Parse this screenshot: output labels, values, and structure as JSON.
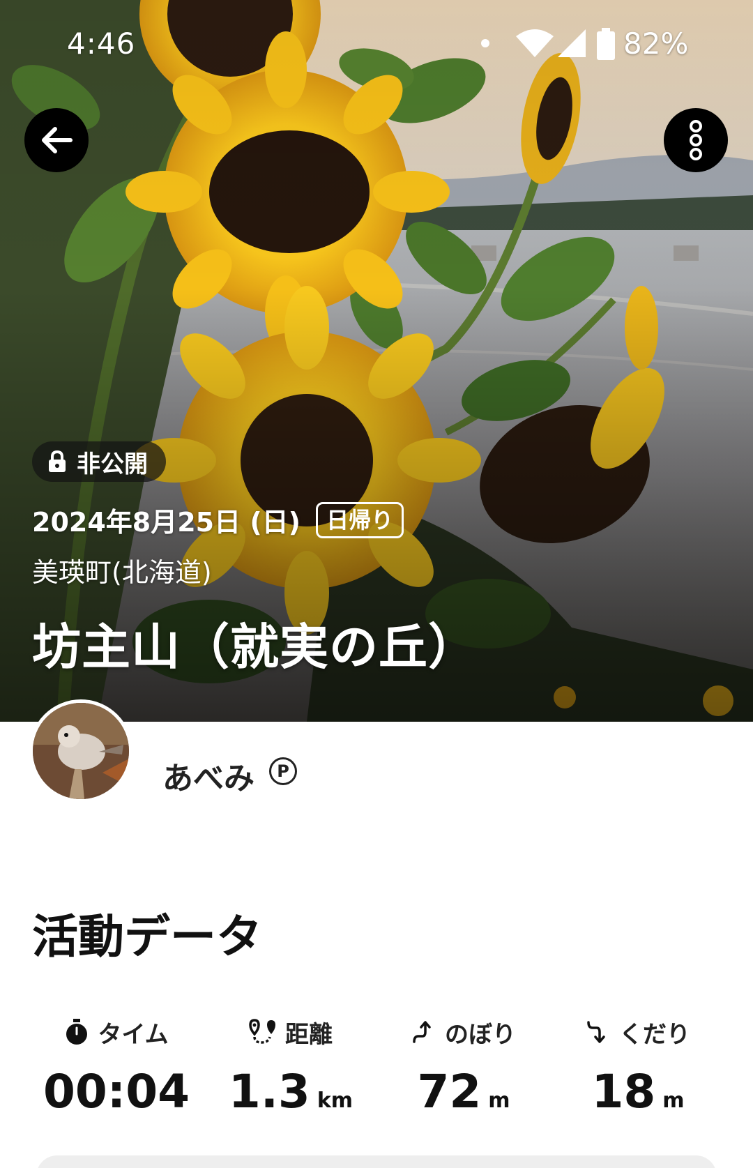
{
  "status_bar": {
    "time": "4:46",
    "battery": "82%",
    "icons": [
      "notification-dot-icon",
      "wifi-icon",
      "signal-icon",
      "battery-icon"
    ]
  },
  "header": {
    "back_icon": "arrow-left-icon",
    "more_icon": "more-vertical-icon",
    "visibility": "非公開",
    "visibility_icon": "lock-icon",
    "date": "2024年8月25日 (日)",
    "trip_type": "日帰り",
    "area": "美瑛町(北海道)",
    "title": "坊主山（就実の丘）"
  },
  "author": {
    "name": "あべみ",
    "badge": "P"
  },
  "activity": {
    "title": "活動データ",
    "stats": [
      {
        "icon": "stopwatch-icon",
        "label": "タイム",
        "value": "00:04",
        "unit": ""
      },
      {
        "icon": "route-icon",
        "label": "距離",
        "value": "1.3",
        "unit": "km"
      },
      {
        "icon": "ascent-icon",
        "label": "のぼり",
        "value": "72",
        "unit": "m"
      },
      {
        "icon": "descent-icon",
        "label": "くだり",
        "value": "18",
        "unit": "m"
      }
    ]
  },
  "colors": {
    "badge_bg": "#141414",
    "button_bg": "#000000",
    "card_bg": "#eeeeee",
    "sunflower_petal": "#f4c21a",
    "sunflower_center": "#2b1a10"
  }
}
